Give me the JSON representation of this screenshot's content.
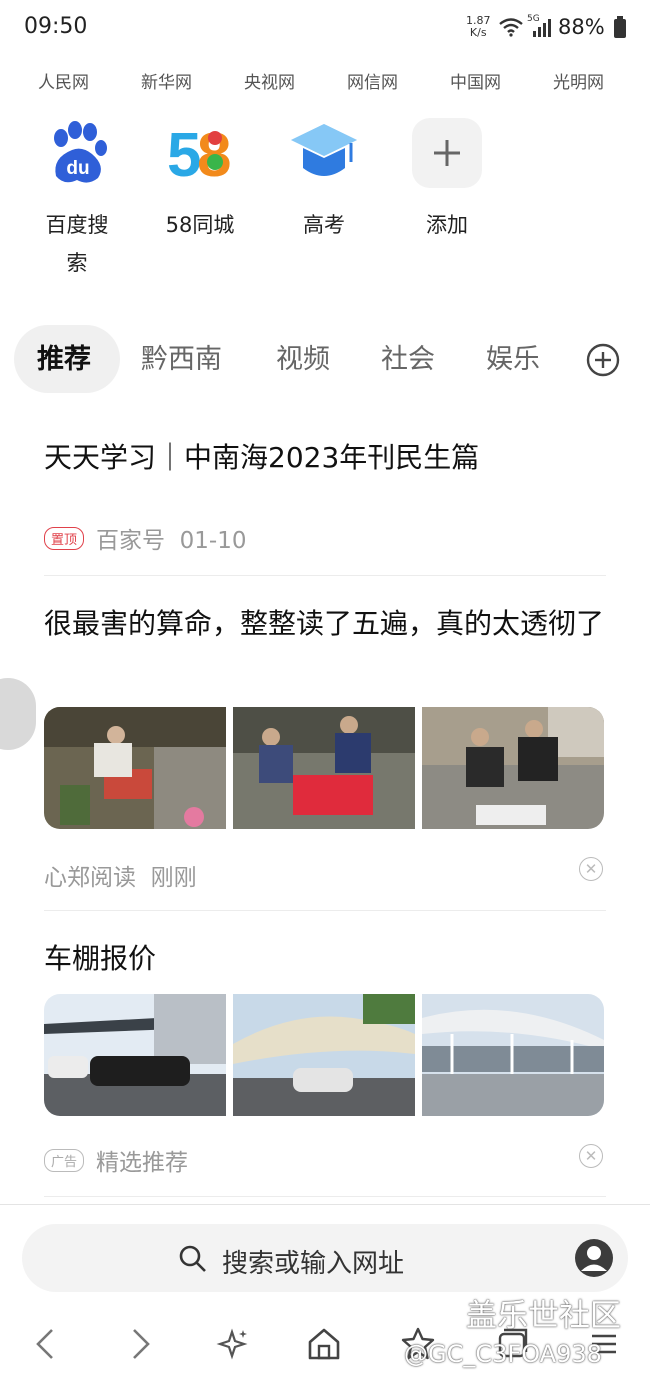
{
  "status_bar": {
    "time": "09:50",
    "net_speed_value": "1.87",
    "net_speed_unit": "K/s",
    "network": "5G",
    "battery": "88%"
  },
  "quick_links": [
    "人民网",
    "新华网",
    "央视网",
    "网信网",
    "中国网",
    "光明网"
  ],
  "shortcuts": [
    {
      "label": "百度搜索",
      "icon": "baidu-paw-icon"
    },
    {
      "label": "58同城",
      "icon": "58-logo-icon"
    },
    {
      "label": "高考",
      "icon": "graduation-cap-icon"
    },
    {
      "label": "添加",
      "icon": "plus-icon"
    }
  ],
  "tabs": [
    "推荐",
    "黔西南",
    "视频",
    "社会",
    "娱乐"
  ],
  "feed": [
    {
      "title": "天天学习｜中南海2023年刊民生篇",
      "badge": "置顶",
      "source": "百家号",
      "time": "01-10"
    },
    {
      "title": "很最害的算命，整整读了五遍，真的太透彻了",
      "source": "心郑阅读",
      "time": "刚刚"
    },
    {
      "title": "车棚报价",
      "badge": "广告",
      "source": "精选推荐"
    }
  ],
  "search": {
    "placeholder": "搜索或输入网址"
  },
  "watermark": {
    "line1": "盖乐世社区",
    "line2": "@GC_C3FOA938"
  },
  "colors": {
    "accent_red": "#e0414a",
    "baidu_blue": "#2f5fd8"
  }
}
